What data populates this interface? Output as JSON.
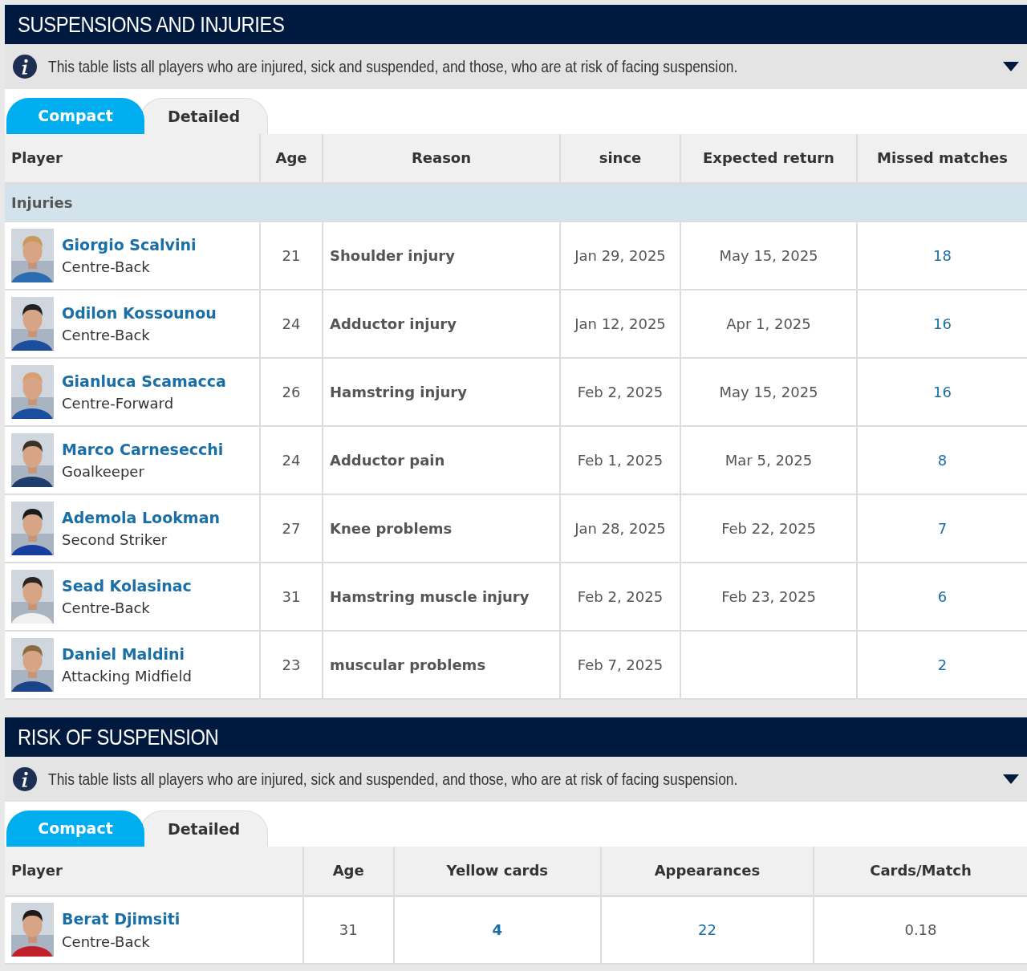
{
  "sections": [
    {
      "title": "SUSPENSIONS AND INJURIES",
      "info": "This table lists all players who are injured, sick and suspended, and those, who are at risk of facing suspension.",
      "tabs": [
        {
          "label": "Compact",
          "selected": true
        },
        {
          "label": "Detailed",
          "selected": false
        }
      ],
      "columns": [
        {
          "label": "Player",
          "kind": "player"
        },
        {
          "label": "Age",
          "kind": "number"
        },
        {
          "label": "Reason",
          "kind": "bold"
        },
        {
          "label": "since",
          "kind": "number"
        },
        {
          "label": "Expected return",
          "kind": "number"
        },
        {
          "label": "Missed matches",
          "kind": "link"
        }
      ],
      "groups": [
        {
          "label": "Injuries",
          "rows": [
            {
              "player": "Giorgio Scalvini",
              "position": "Centre-Back",
              "cells": [
                "21",
                "Shoulder injury",
                "Jan 29, 2025",
                "May 15, 2025",
                "18"
              ]
            },
            {
              "player": "Odilon Kossounou",
              "position": "Centre-Back",
              "cells": [
                "24",
                "Adductor injury",
                "Jan 12, 2025",
                "Apr 1, 2025",
                "16"
              ]
            },
            {
              "player": "Gianluca Scamacca",
              "position": "Centre-Forward",
              "cells": [
                "26",
                "Hamstring injury",
                "Feb 2, 2025",
                "May 15, 2025",
                "16"
              ]
            },
            {
              "player": "Marco Carnesecchi",
              "position": "Goalkeeper",
              "cells": [
                "24",
                "Adductor pain",
                "Feb 1, 2025",
                "Mar 5, 2025",
                "8"
              ]
            },
            {
              "player": "Ademola Lookman",
              "position": "Second Striker",
              "cells": [
                "27",
                "Knee problems",
                "Jan 28, 2025",
                "Feb 22, 2025",
                "7"
              ]
            },
            {
              "player": "Sead Kolasinac",
              "position": "Centre-Back",
              "cells": [
                "31",
                "Hamstring muscle injury",
                "Feb 2, 2025",
                "Feb 23, 2025",
                "6"
              ]
            },
            {
              "player": "Daniel Maldini",
              "position": "Attacking Midfield",
              "cells": [
                "23",
                "muscular problems",
                "Feb 7, 2025",
                null,
                "2"
              ]
            }
          ]
        }
      ]
    },
    {
      "title": "RISK OF SUSPENSION",
      "info": "This table lists all players who are injured, sick and suspended, and those, who are at risk of facing suspension.",
      "tabs": [
        {
          "label": "Compact",
          "selected": true
        },
        {
          "label": "Detailed",
          "selected": false
        }
      ],
      "columns": [
        {
          "label": "Player",
          "kind": "player"
        },
        {
          "label": "Age",
          "kind": "number"
        },
        {
          "label": "Yellow cards",
          "kind": "strong-link"
        },
        {
          "label": "Appearances",
          "kind": "link"
        },
        {
          "label": "Cards/Match",
          "kind": "number"
        }
      ],
      "groups": [
        {
          "rows": [
            {
              "player": "Berat Djimsiti",
              "position": "Centre-Back",
              "cells": [
                "31",
                "4",
                "22",
                "0.18"
              ]
            }
          ]
        }
      ]
    }
  ]
}
